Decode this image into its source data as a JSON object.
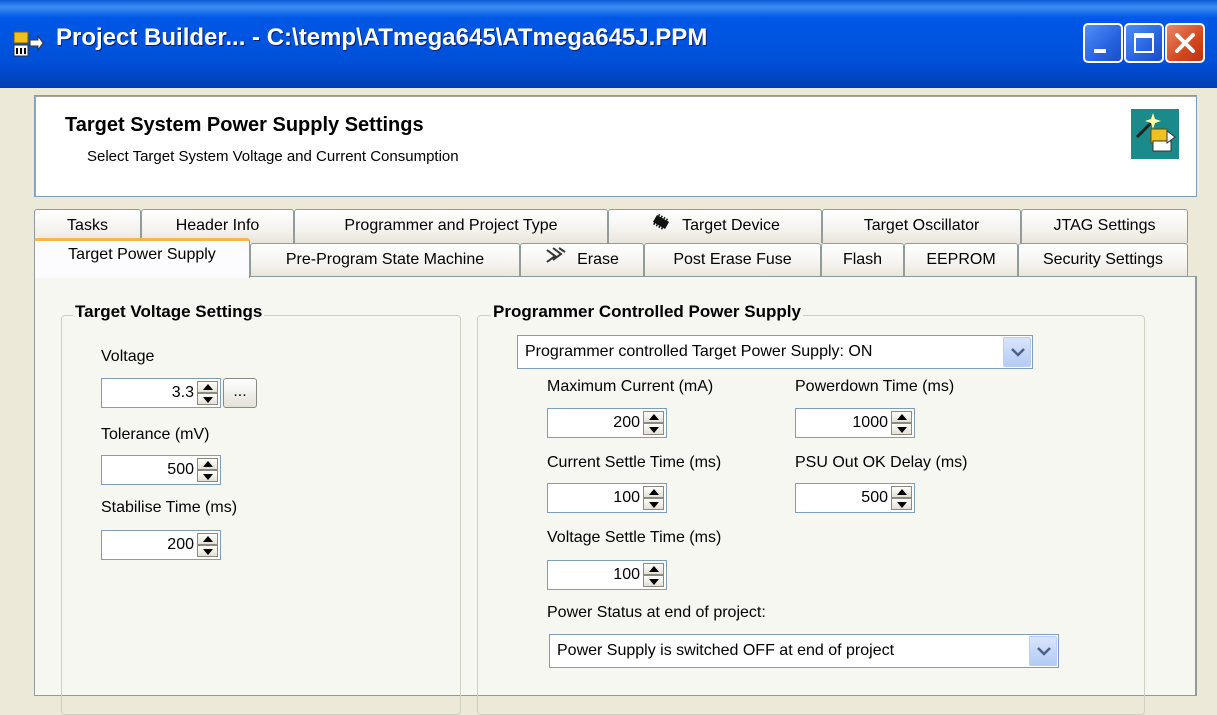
{
  "window": {
    "title": "Project Builder... - C:\\temp\\ATmega645\\ATmega645J.PPM",
    "app_icon": "project-builder-icon"
  },
  "header": {
    "title": "Target System Power Supply Settings",
    "subtitle": "Select Target System Voltage and Current Consumption",
    "icon": "wizard-icon"
  },
  "tabs_row1": [
    {
      "label": "Tasks"
    },
    {
      "label": "Header Info"
    },
    {
      "label": "Programmer and Project Type"
    },
    {
      "label": "Target Device",
      "icon": "chip-icon"
    },
    {
      "label": "Target Oscillator"
    },
    {
      "label": "JTAG Settings"
    }
  ],
  "tabs_row2": [
    {
      "label": "Target Power Supply",
      "selected": true
    },
    {
      "label": "Pre-Program State Machine"
    },
    {
      "label": "Erase",
      "icon": "erase-icon"
    },
    {
      "label": "Post Erase Fuse"
    },
    {
      "label": "Flash"
    },
    {
      "label": "EEPROM"
    },
    {
      "label": "Security Settings"
    }
  ],
  "target_voltage": {
    "group_title": "Target Voltage Settings",
    "voltage_label": "Voltage",
    "voltage_value": "3.3",
    "browse_label": "...",
    "tolerance_label": "Tolerance  (mV)",
    "tolerance_value": "500",
    "stabilise_label": "Stabilise Time (ms)",
    "stabilise_value": "200"
  },
  "power_supply": {
    "group_title": "Programmer Controlled Power Supply",
    "mode_value": "Programmer controlled Target Power Supply: ON",
    "max_current_label": "Maximum Current (mA)",
    "max_current_value": "200",
    "powerdown_label": "Powerdown Time (ms)",
    "powerdown_value": "1000",
    "current_settle_label": "Current Settle Time (ms)",
    "current_settle_value": "100",
    "psu_ok_label": "PSU Out OK Delay (ms)",
    "psu_ok_value": "500",
    "voltage_settle_label": "Voltage Settle Time (ms)",
    "voltage_settle_value": "100",
    "status_label": "Power Status at end of project:",
    "status_value": "Power Supply is switched OFF at end of project"
  }
}
